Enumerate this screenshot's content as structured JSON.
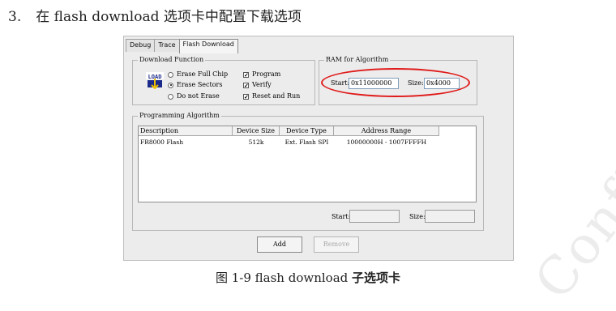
{
  "heading": {
    "number": "3.",
    "text": "在 flash download 选项卡中配置下载选项"
  },
  "dialog": {
    "tabs": [
      {
        "label": "Debug"
      },
      {
        "label": "Trace"
      },
      {
        "label": "Flash Download",
        "active": true
      }
    ],
    "download_function": {
      "title": "Download Function",
      "icon_text": "LOAD",
      "erase_options": [
        {
          "label": "Erase Full Chip",
          "selected": false
        },
        {
          "label": "Erase Sectors",
          "selected": true
        },
        {
          "label": "Do not Erase",
          "selected": false
        }
      ],
      "checks": [
        {
          "label": "Program",
          "checked": true
        },
        {
          "label": "Verify",
          "checked": true
        },
        {
          "label": "Reset and Run",
          "checked": true
        }
      ]
    },
    "ram_for_algorithm": {
      "title": "RAM for Algorithm",
      "start_label": "Start:",
      "start_value": "0x11000000",
      "size_label": "Size:",
      "size_value": "0x4000",
      "highlight_color": "#e01a1a"
    },
    "programming_algorithm": {
      "title": "Programming Algorithm",
      "columns": [
        "Description",
        "Device Size",
        "Device Type",
        "Address Range"
      ],
      "rows": [
        [
          "FR8000 Flash",
          "512k",
          "Ext. Flash SPI",
          "10000000H - 1007FFFFH"
        ]
      ],
      "start_label": "Start:",
      "start_value": "",
      "size_label": "Size:",
      "size_value": ""
    },
    "buttons": {
      "add": "Add",
      "remove": "Remove"
    }
  },
  "caption": {
    "prefix": "图 1-9 flash download ",
    "suffix": "子选项卡"
  },
  "watermark": "Confidential"
}
